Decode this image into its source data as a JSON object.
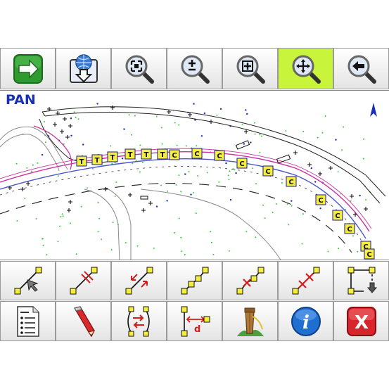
{
  "map": {
    "mode_label": "PAN",
    "marker_labels": [
      "T",
      "T",
      "T",
      "T",
      "T",
      "T",
      "C",
      "C",
      "C",
      "C",
      "C",
      "C",
      "C",
      "C",
      "C",
      "C",
      "C"
    ]
  },
  "toolbar_top": [
    {
      "name": "next-button",
      "icon": "green-arrow-right-icon",
      "active": false
    },
    {
      "name": "download-map-button",
      "icon": "globe-download-icon",
      "active": false
    },
    {
      "name": "zoom-extent-button",
      "icon": "magnifier-extent-icon",
      "active": false
    },
    {
      "name": "zoom-in-out-button",
      "icon": "magnifier-plus-minus-icon",
      "active": false
    },
    {
      "name": "zoom-window-button",
      "icon": "magnifier-window-icon",
      "active": false
    },
    {
      "name": "pan-button",
      "icon": "magnifier-pan-icon",
      "active": true
    },
    {
      "name": "zoom-previous-button",
      "icon": "magnifier-arrow-left-icon",
      "active": false
    }
  ],
  "toolbar_row1": [
    {
      "name": "select-line-button",
      "icon": "line-cursor-icon"
    },
    {
      "name": "split-line-button",
      "icon": "line-split-icon"
    },
    {
      "name": "reverse-line-button",
      "icon": "line-reverse-icon"
    },
    {
      "name": "polyline-button",
      "icon": "polyline-icon"
    },
    {
      "name": "delete-vertex-button",
      "icon": "polyline-delete-vertex-icon"
    },
    {
      "name": "delete-vertices-button",
      "icon": "polyline-delete-vertices-icon"
    },
    {
      "name": "close-polygon-button",
      "icon": "polygon-close-icon"
    }
  ],
  "toolbar_row2": [
    {
      "name": "point-list-button",
      "icon": "list-document-icon"
    },
    {
      "name": "edit-button",
      "icon": "pencil-icon"
    },
    {
      "name": "curve-offset-button",
      "icon": "curve-offset-icon"
    },
    {
      "name": "offset-distance-button",
      "icon": "offset-distance-icon",
      "label": "d"
    },
    {
      "name": "stakeout-button",
      "icon": "stake-icon"
    },
    {
      "name": "info-button",
      "icon": "info-icon",
      "label": "i"
    },
    {
      "name": "close-button",
      "icon": "close-icon",
      "label": "X"
    }
  ],
  "colors": {
    "active": "#c8f53c",
    "mode_text": "#1a2fb8",
    "marker_fill": "#f5ee3c",
    "alignment": "#cc2fa0",
    "road_edge": "#4a57c8",
    "points": "#33cc33"
  }
}
